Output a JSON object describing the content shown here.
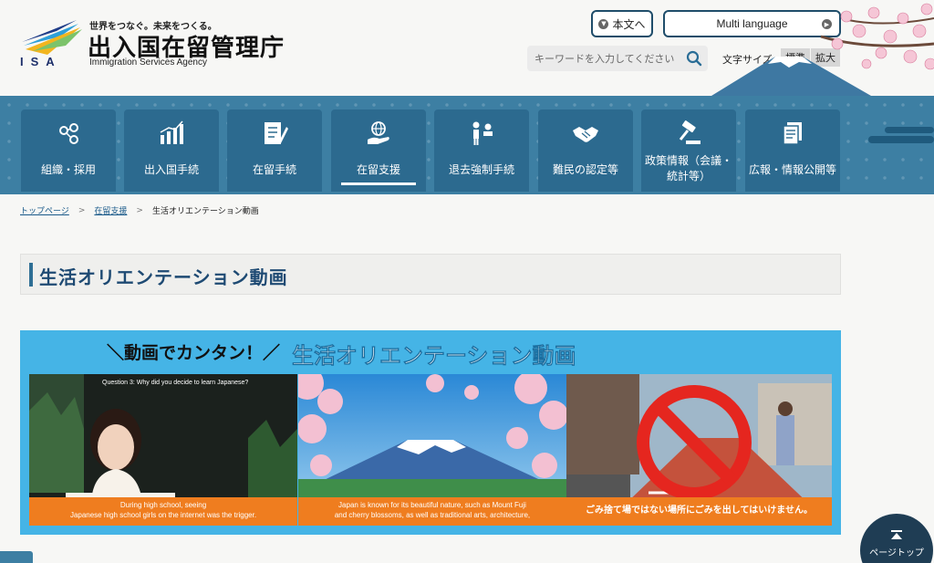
{
  "header": {
    "logo_letters": "ISA",
    "tagline": "世界をつなぐ。未来をつくる。",
    "agency_name_ja": "出入国在留管理庁",
    "agency_name_en": "Immigration Services Agency",
    "skip_label": "本文へ",
    "multi_language_label": "Multi language",
    "search_placeholder": "キーワードを入力してください",
    "font_size_label": "文字サイズ",
    "font_size_normal": "標準",
    "font_size_large": "拡大"
  },
  "nav": {
    "items": [
      {
        "label": "組織・採用",
        "icon": "people-network-icon"
      },
      {
        "label": "出入国手続",
        "icon": "bar-chart-icon"
      },
      {
        "label": "在留手続",
        "icon": "document-pen-icon"
      },
      {
        "label": "在留支援",
        "icon": "globe-hand-icon"
      },
      {
        "label": "退去強制手続",
        "icon": "two-people-icon"
      },
      {
        "label": "難民の認定等",
        "icon": "handshake-icon"
      },
      {
        "label": "政策情報（会議・統計等）",
        "line1": "政策情報（会議・",
        "line2": "統計等）",
        "icon": "gavel-icon"
      },
      {
        "label": "広報・情報公開等",
        "icon": "documents-icon"
      }
    ],
    "active_index": 3
  },
  "breadcrumb": {
    "home": "トップページ",
    "parent": "在留支援",
    "current": "生活オリエンテーション動画"
  },
  "page_title": "生活オリエンテーション動画",
  "banner": {
    "left_text": "＼動画でカンタン！／",
    "right_text": "生活オリエンテーション動画",
    "thumbnails": [
      {
        "question": "Question 3: Why did you decide to learn Japanese?",
        "caption_line1": "During high school, seeing",
        "caption_line2": "Japanese high school girls on the internet was the trigger."
      },
      {
        "caption_line1": "Japan is known for its beautiful nature, such as Mount Fuji",
        "caption_line2": "and cherry blossoms, as well as traditional arts, architecture,"
      },
      {
        "caption_line1": "ごみ捨て場ではない場所にごみを出してはいけません。"
      }
    ]
  },
  "page_top_label": "ページトップ",
  "colors": {
    "nav_bg": "#3d7fa3",
    "nav_item": "#2c6a8f",
    "banner_bg": "#45b4e6",
    "caption_bg": "#ef7d1f",
    "title_text": "#1e4a73"
  }
}
